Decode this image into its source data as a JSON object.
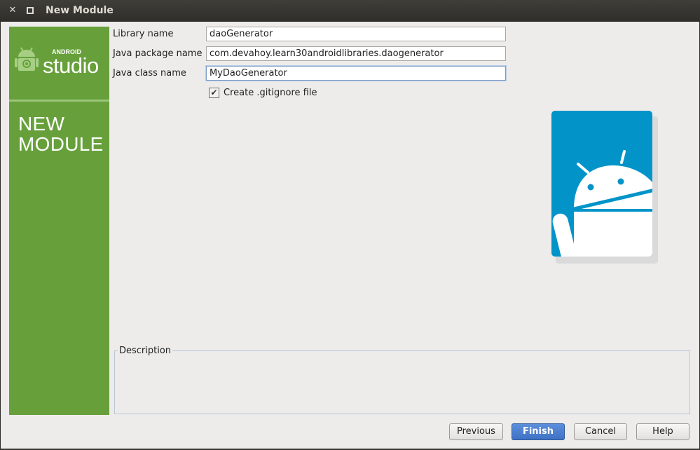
{
  "window": {
    "title": "New Module",
    "close_glyph": "✕",
    "maximize_glyph": ""
  },
  "sidebar": {
    "logo_small": "ANDROID",
    "logo_big": "studio",
    "heading_line1": "NEW",
    "heading_line2": "MODULE"
  },
  "form": {
    "library_name": {
      "label": "Library name",
      "value": "daoGenerator"
    },
    "java_package_name": {
      "label": "Java package name",
      "value": "com.devahoy.learn30androidlibraries.daogenerator"
    },
    "java_class_name": {
      "label": "Java class name",
      "value": "MyDaoGenerator"
    },
    "gitignore": {
      "label": "Create .gitignore file",
      "checked": true,
      "check_glyph": "✔"
    }
  },
  "description": {
    "title": "Description"
  },
  "buttons": {
    "previous": "Previous",
    "finish": "Finish",
    "cancel": "Cancel",
    "help": "Help"
  },
  "colors": {
    "sidebar_green": "#67a03b",
    "illustration_blue": "#0294c9",
    "primary_button": "#4a7fd0"
  }
}
